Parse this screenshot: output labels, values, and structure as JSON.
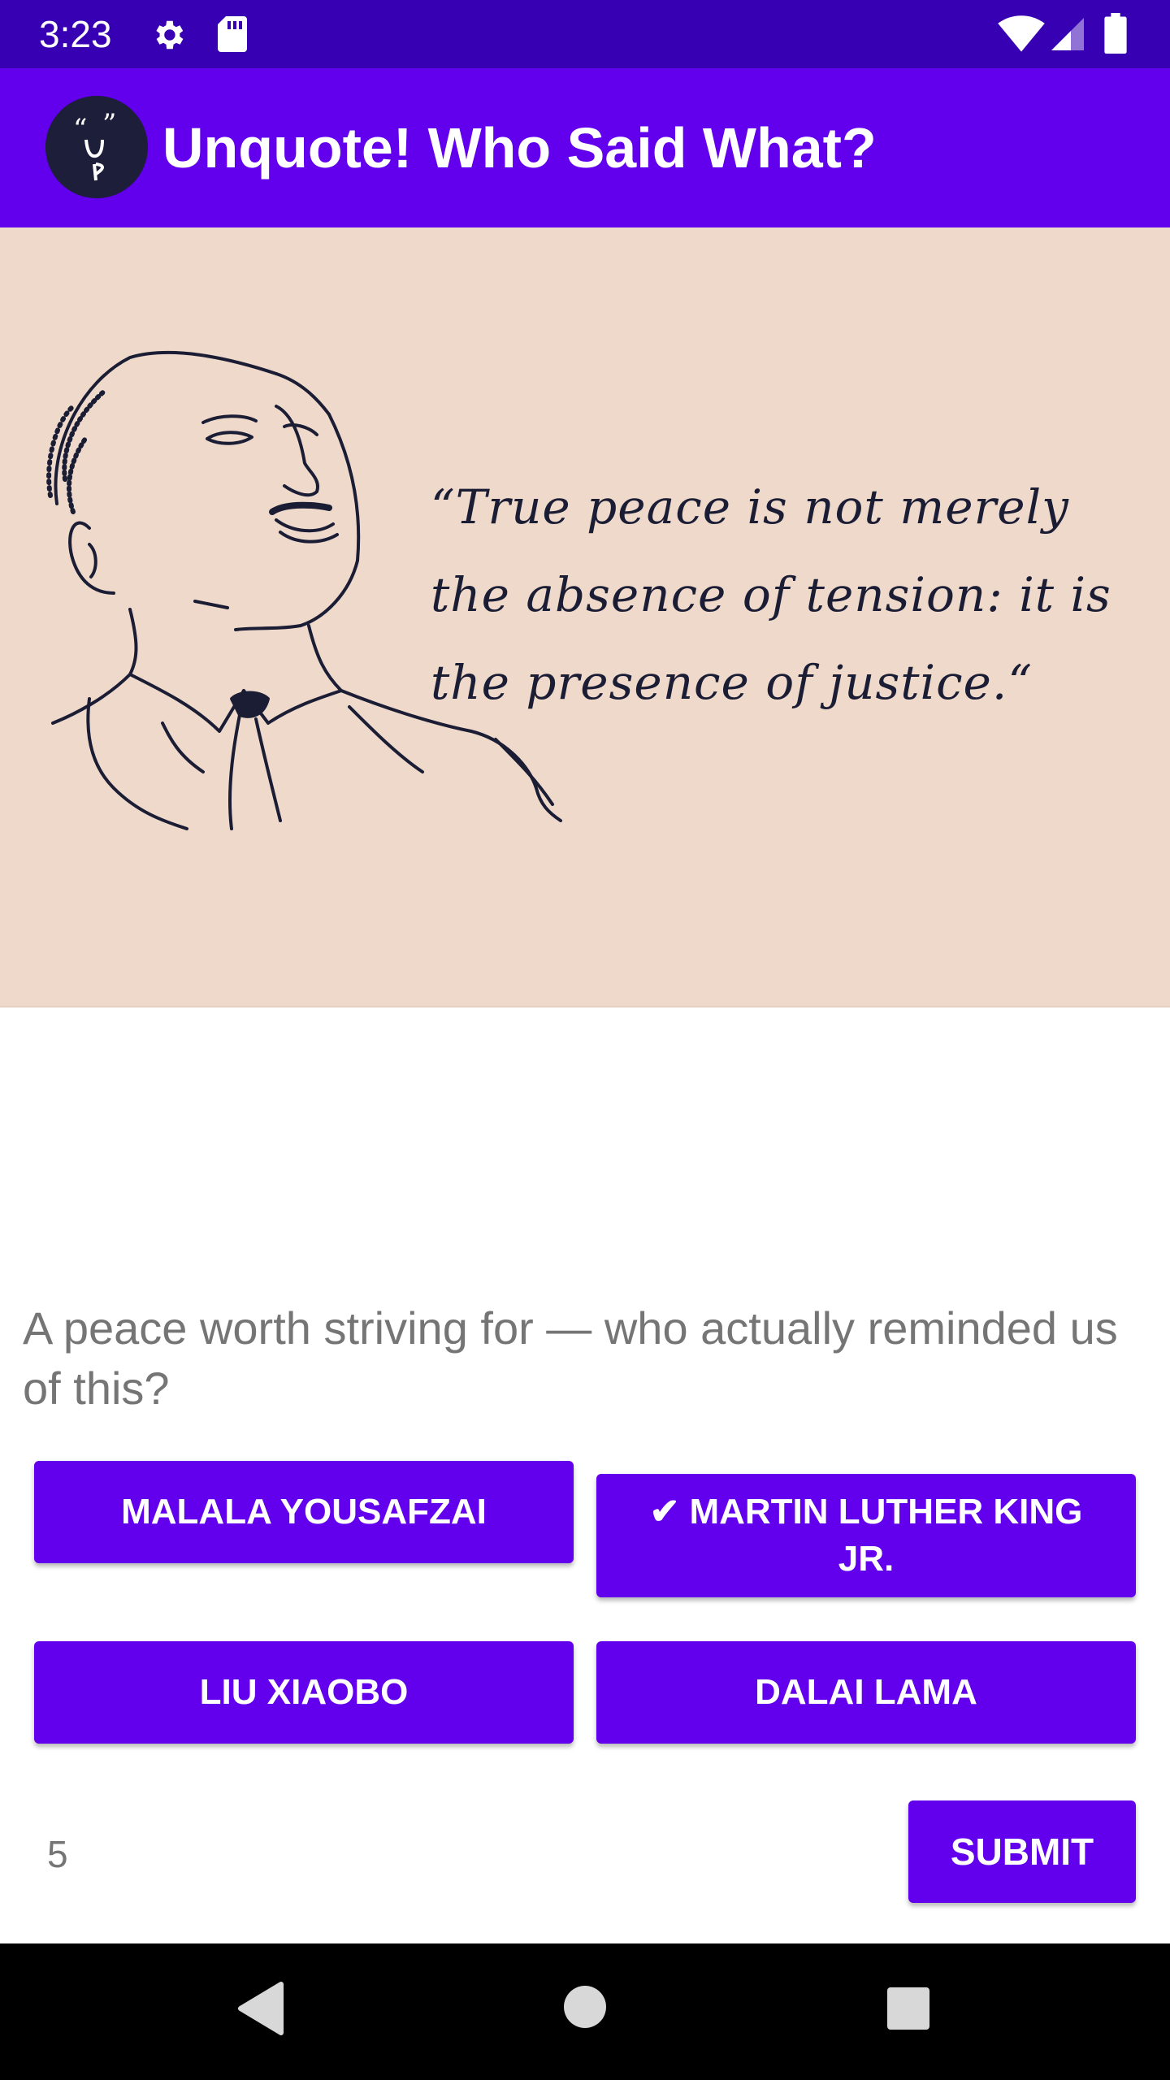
{
  "status_bar": {
    "time": "3:23",
    "icons": [
      "gear-icon",
      "sd-card-icon",
      "wifi-icon",
      "signal-icon",
      "battery-icon"
    ]
  },
  "app_bar": {
    "title": "Unquote! Who Said What?",
    "logo_icon": "unquote-logo"
  },
  "quote_card": {
    "quote_text": "“True peace is not merely the absence of tension: it is the presence of justice.“",
    "background_color": "#efd9cb",
    "ink_color": "#1b1d35"
  },
  "question": {
    "text": "A peace worth striving for — who actually reminded us of this?"
  },
  "answers": [
    {
      "label": "MALALA YOUSAFZAI",
      "selected": false
    },
    {
      "label": "MARTIN LUTHER KING JR.",
      "selected": true,
      "check_mark": "✔"
    },
    {
      "label": "LIU XIAOBO",
      "selected": false
    },
    {
      "label": "DALAI LAMA",
      "selected": false
    }
  ],
  "footer": {
    "score": "5",
    "submit_label": "SUBMIT"
  },
  "colors": {
    "primary": "#6200ee",
    "primary_dark": "#3700b3",
    "question_text": "#757575"
  },
  "nav_bar": {
    "icons": [
      "back-icon",
      "home-icon",
      "recents-icon"
    ]
  }
}
